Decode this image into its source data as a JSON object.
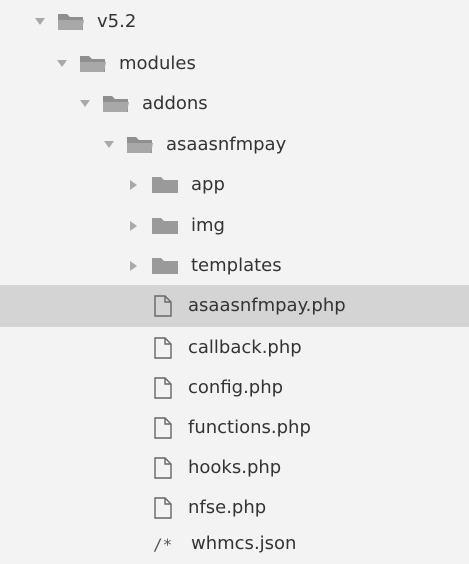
{
  "tree": {
    "items": [
      {
        "label": "v5.2",
        "type": "folder-open",
        "expanded": true
      },
      {
        "label": "modules",
        "type": "folder-open",
        "expanded": true
      },
      {
        "label": "addons",
        "type": "folder-open",
        "expanded": true
      },
      {
        "label": "asaasnfmpay",
        "type": "folder-open",
        "expanded": true
      },
      {
        "label": "app",
        "type": "folder",
        "expanded": false
      },
      {
        "label": "img",
        "type": "folder",
        "expanded": false
      },
      {
        "label": "templates",
        "type": "folder",
        "expanded": false
      },
      {
        "label": "asaasnfmpay.php",
        "type": "file",
        "selected": true
      },
      {
        "label": "callback.php",
        "type": "file"
      },
      {
        "label": "config.php",
        "type": "file"
      },
      {
        "label": "functions.php",
        "type": "file"
      },
      {
        "label": "hooks.php",
        "type": "file"
      },
      {
        "label": "nfse.php",
        "type": "file"
      },
      {
        "label": "whmcs.json",
        "type": "json",
        "icon_text": "/*"
      }
    ]
  },
  "colors": {
    "background": "#f3f3f3",
    "selected": "#d4d4d4",
    "folder": "#9a9a9a",
    "arrow": "#a9a9a9",
    "text": "#333333"
  },
  "icons": {
    "expanded": "triangle-down-icon",
    "collapsed": "triangle-right-icon",
    "folder_open": "folder-open-icon",
    "folder": "folder-icon",
    "file": "file-icon",
    "json": "json-comment-icon"
  }
}
